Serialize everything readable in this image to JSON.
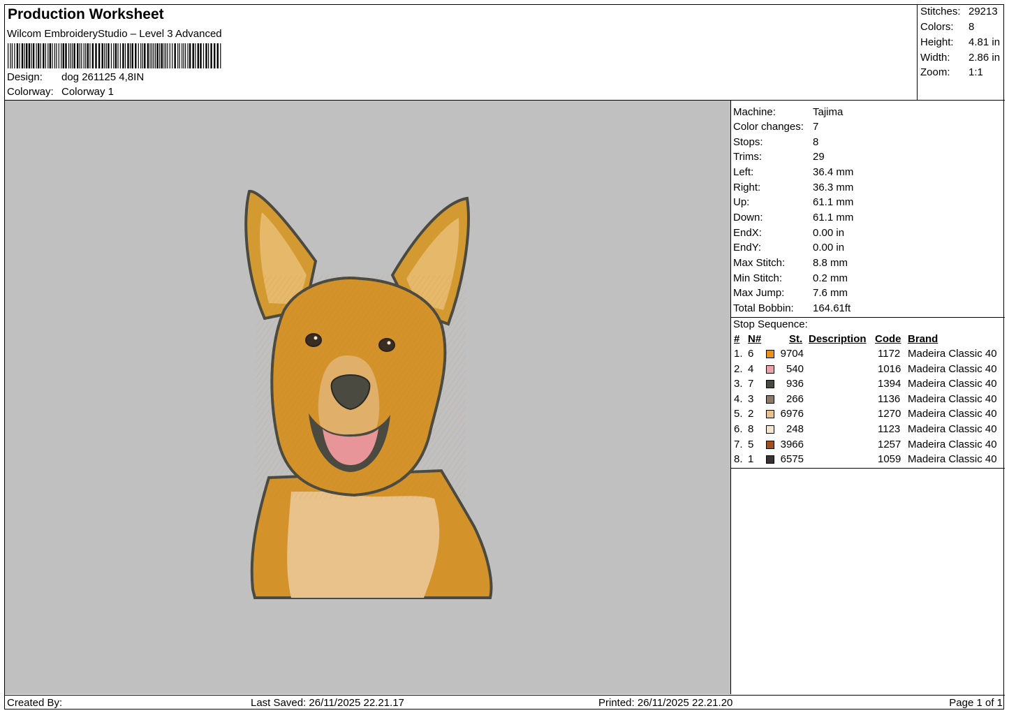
{
  "header": {
    "title": "Production Worksheet",
    "subtitle": "Wilcom EmbroideryStudio – Level 3 Advanced",
    "design_label": "Design:",
    "design_value": "dog 261125 4,8IN",
    "colorway_label": "Colorway:",
    "colorway_value": "Colorway 1"
  },
  "summary": [
    {
      "label": "Stitches:",
      "value": "29213"
    },
    {
      "label": "Colors:",
      "value": "8"
    },
    {
      "label": "Height:",
      "value": "4.81 in"
    },
    {
      "label": "Width:",
      "value": "2.86 in"
    },
    {
      "label": "Zoom:",
      "value": "1:1"
    }
  ],
  "machine_info": [
    {
      "label": "Machine:",
      "value": "Tajima"
    },
    {
      "label": "Color changes:",
      "value": "7"
    },
    {
      "label": "Stops:",
      "value": "8"
    },
    {
      "label": "Trims:",
      "value": "29"
    },
    {
      "label": "Left:",
      "value": "36.4 mm"
    },
    {
      "label": "Right:",
      "value": "36.3 mm"
    },
    {
      "label": "Up:",
      "value": "61.1 mm"
    },
    {
      "label": "Down:",
      "value": "61.1 mm"
    },
    {
      "label": "EndX:",
      "value": "0.00 in"
    },
    {
      "label": "EndY:",
      "value": "0.00 in"
    },
    {
      "label": "Max Stitch:",
      "value": "8.8 mm"
    },
    {
      "label": "Min Stitch:",
      "value": "0.2 mm"
    },
    {
      "label": "Max Jump:",
      "value": "7.6 mm"
    },
    {
      "label": "Total Bobbin:",
      "value": "164.61ft"
    }
  ],
  "stop_sequence": {
    "title": "Stop Sequence:",
    "headers": {
      "num": "#",
      "n": "N#",
      "st": "St.",
      "description": "Description",
      "code": "Code",
      "brand": "Brand"
    },
    "rows": [
      {
        "num": "1.",
        "n": "6",
        "color": "#e8921e",
        "st": "9704",
        "code": "1172",
        "brand": "Madeira Classic 40"
      },
      {
        "num": "2.",
        "n": "4",
        "color": "#f0a0a8",
        "st": "540",
        "code": "1016",
        "brand": "Madeira Classic 40"
      },
      {
        "num": "3.",
        "n": "7",
        "color": "#4a4a40",
        "st": "936",
        "code": "1394",
        "brand": "Madeira Classic 40"
      },
      {
        "num": "4.",
        "n": "3",
        "color": "#8c7a68",
        "st": "266",
        "code": "1136",
        "brand": "Madeira Classic 40"
      },
      {
        "num": "5.",
        "n": "2",
        "color": "#e8c28a",
        "st": "6976",
        "code": "1270",
        "brand": "Madeira Classic 40"
      },
      {
        "num": "6.",
        "n": "8",
        "color": "#f4e6cc",
        "st": "248",
        "code": "1123",
        "brand": "Madeira Classic 40"
      },
      {
        "num": "7.",
        "n": "5",
        "color": "#a0501c",
        "st": "3966",
        "code": "1257",
        "brand": "Madeira Classic 40"
      },
      {
        "num": "8.",
        "n": "1",
        "color": "#3a3232",
        "st": "6575",
        "code": "1059",
        "brand": "Madeira Classic 40"
      }
    ]
  },
  "footer": {
    "created_by": "Created By:",
    "last_saved": "Last Saved: 26/11/2025 22.21.17",
    "printed": "Printed: 26/11/2025 22.21.20",
    "page": "Page 1 of 1"
  }
}
